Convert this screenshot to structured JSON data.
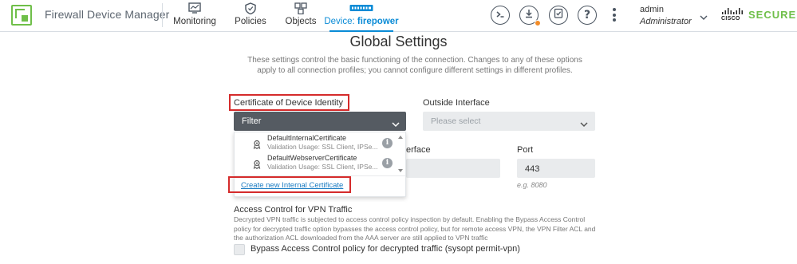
{
  "header": {
    "app_title": "Firewall Device Manager",
    "nav": [
      {
        "label": "Monitoring",
        "icon": "monitoring-icon"
      },
      {
        "label": "Policies",
        "icon": "policies-icon"
      },
      {
        "label": "Objects",
        "icon": "objects-icon"
      },
      {
        "label_prefix": "Device: ",
        "label_value": "firepower",
        "icon": "device-icon",
        "active": true
      }
    ],
    "toolbar_icons": [
      "cli-console-icon",
      "deploy-icon",
      "task-list-icon",
      "help-icon",
      "more-options-icon"
    ],
    "user": {
      "name": "admin",
      "role": "Administrator"
    },
    "brand": {
      "vendor": "CISCO",
      "product": "SECURE"
    },
    "colors": {
      "accent": "#0a8bd6",
      "brand_green": "#6fbf49",
      "deploy_badge": "#f28c28",
      "highlight": "#d52b2b"
    }
  },
  "page": {
    "title": "Global Settings",
    "description": "These settings control the basic functioning of the connection. Changes to any of these options apply to all connection profiles; you cannot configure different settings in different profiles."
  },
  "certificate": {
    "label": "Certificate of Device Identity",
    "filter_label": "Filter",
    "options": [
      {
        "name": "DefaultInternalCertificate",
        "usage": "Validation Usage: SSL Client, IPSe..."
      },
      {
        "name": "DefaultWebserverCertificate",
        "usage": "Validation Usage: SSL Client, IPSe..."
      }
    ],
    "create_link": "Create new Internal Certificate"
  },
  "outside_interface": {
    "label": "Outside Interface",
    "placeholder": "Please select"
  },
  "hidden_field_label_fragment": "erface",
  "port": {
    "label": "Port",
    "value": "443",
    "hint": "e.g. 8080"
  },
  "vpn_access": {
    "title": "Access Control for VPN Traffic",
    "description": "Decrypted VPN traffic is subjected to access control policy inspection by default. Enabling the Bypass Access Control policy for decrypted traffic option bypasses the access control policy, but for remote access VPN, the VPN Filter ACL and the authorization ACL downloaded from the AAA server are still applied to VPN traffic",
    "checkbox_label": "Bypass Access Control policy for decrypted traffic (sysopt permit-vpn)",
    "checked": false
  }
}
